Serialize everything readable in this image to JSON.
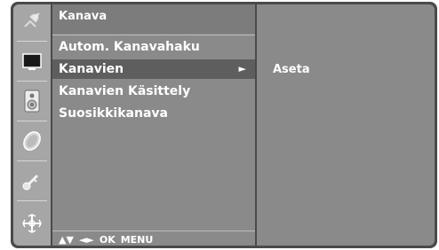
{
  "menu": {
    "title": "Kanava",
    "items": [
      {
        "label": "Autom. Kanavahaku",
        "selected": false
      },
      {
        "label": "Kanavien",
        "selected": true,
        "arrow": "►"
      },
      {
        "label": "Kanavien Käsittely",
        "selected": false
      },
      {
        "label": "Suosikkikanava",
        "selected": false
      }
    ]
  },
  "submenu": {
    "items": [
      {
        "label": "Aseta"
      }
    ]
  },
  "nav_hints": {
    "up_down": "▲▼",
    "left_right": "◄►",
    "ok": "OK",
    "menu": "MENU"
  },
  "icons": [
    "satellite-dish-icon",
    "screen-icon",
    "speaker-icon",
    "clock-icon",
    "key-icon",
    "settings-cross-icon"
  ],
  "colors": {
    "frame": "#4a4a4a",
    "icon_column": "#a6a6a6",
    "panel": "#8a8a8a",
    "selected_row": "#5e5e5e",
    "text": "#ffffff"
  }
}
